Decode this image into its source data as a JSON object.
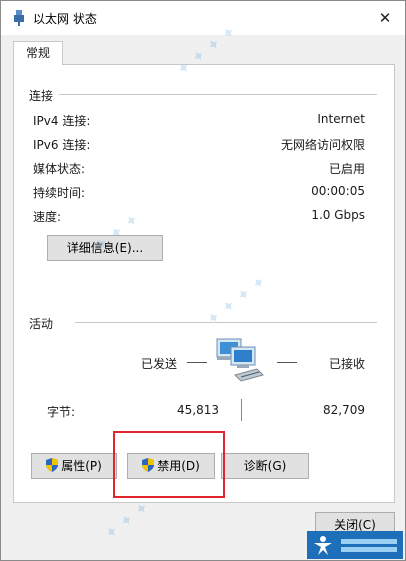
{
  "window": {
    "title": "以太网 状态",
    "close_glyph": "✕"
  },
  "tabs": [
    {
      "label": "常规"
    }
  ],
  "connection": {
    "section_label": "连接",
    "rows": [
      {
        "label": "IPv4 连接:",
        "value": "Internet"
      },
      {
        "label": "IPv6 连接:",
        "value": "无网络访问权限"
      },
      {
        "label": "媒体状态:",
        "value": "已启用"
      },
      {
        "label": "持续时间:",
        "value": "00:00:05"
      },
      {
        "label": "速度:",
        "value": "1.0 Gbps"
      }
    ],
    "details_button": "详细信息(E)..."
  },
  "activity": {
    "section_label": "活动",
    "sent_label": "已发送",
    "received_label": "已接收",
    "bytes_label": "字节:",
    "bytes_sent": "45,813",
    "bytes_received": "82,709",
    "network_icon": "network-computers-icon"
  },
  "buttons": {
    "properties": "属性(P)",
    "disable": "禁用(D)",
    "diagnose": "诊断(G)",
    "close": "关闭(C)"
  },
  "colors": {
    "highlight_border": "#e0262c",
    "accent_blue": "#1e6fb9"
  }
}
